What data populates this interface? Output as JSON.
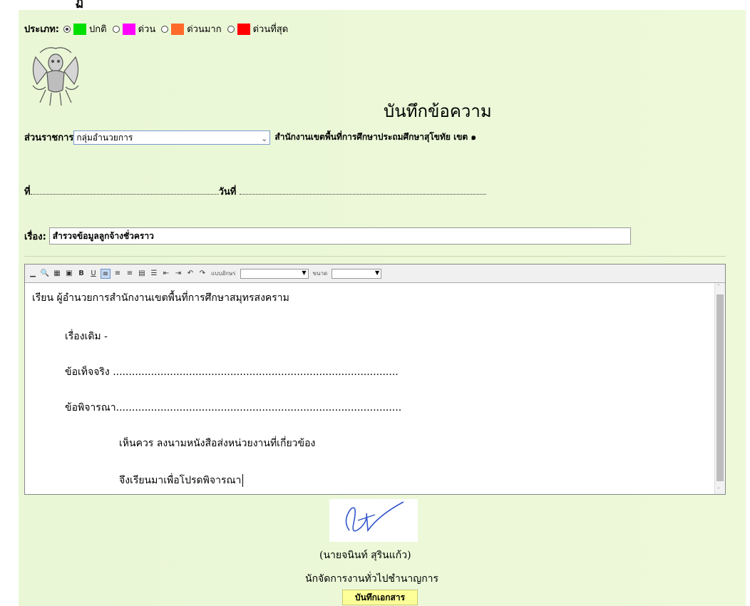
{
  "header_partial_glyph": "ฏิ",
  "priority": {
    "label": "ประเภท:",
    "options": [
      {
        "label": "ปกติ",
        "color": "#00e000",
        "selected": true
      },
      {
        "label": "ด่วน",
        "color": "#ff00ff",
        "selected": false
      },
      {
        "label": "ด่วนมาก",
        "color": "#ff6a2a",
        "selected": false
      },
      {
        "label": "ด่วนที่สุด",
        "color": "#ff0000",
        "selected": false
      }
    ]
  },
  "emblem_icon": "garuda-emblem-icon",
  "memo_title": "บันทึกข้อความ",
  "department": {
    "label": "ส่วนราชการ",
    "selected": "กลุ่มอำนวยการ",
    "office": "สำนักงานเขตพื้นที่การศึกษาประถมศึกษาสุโขทัย เขต ๑"
  },
  "ref": {
    "no_label": "ที่",
    "date_label": "วันที่"
  },
  "subject": {
    "label": "เรื่อง:",
    "value": "สำรวจข้อมูลลูกจ้างชั่วคราว"
  },
  "toolbar": {
    "font_label": "แบบอักษร",
    "size_label": "ขนาด"
  },
  "body": {
    "salutation": "เรียน  ผู้อำนวยการสำนักงานเขตพื้นที่การศึกษาสมุทรสงคราม",
    "line1": "เรื่องเดิม  -",
    "line2": "ข้อเท็จจริง  ..........................................................................................",
    "line3": "ข้อพิจารณา..........................................................................................",
    "line4": "เห็นควร  ลงนามหนังสือส่งหน่วยงานที่เกี่ยวข้อง",
    "line5": "จึงเรียนมาเพื่อโปรดพิจารณา"
  },
  "signer": {
    "name": "(นายจนินท์ สุรินแก้ว)",
    "position": "นักจัดการงานทั่วไปชำนาญการ"
  },
  "save_button": "บันทึกเอกสาร"
}
